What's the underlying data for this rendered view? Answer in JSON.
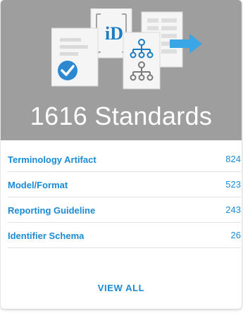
{
  "card": {
    "title": "1616 Standards",
    "header_color": "#9e9e9e",
    "accent_color": "#1a8bd6",
    "art_icons": [
      "document-check-icon",
      "identifier-id-icon",
      "hierarchy-tree-icon",
      "table-export-arrow-icon"
    ],
    "art_id_text": "iD"
  },
  "items": [
    {
      "label": "Terminology Artifact",
      "count": "824"
    },
    {
      "label": "Model/Format",
      "count": "523"
    },
    {
      "label": "Reporting Guideline",
      "count": "243"
    },
    {
      "label": "Identifier Schema",
      "count": "26"
    }
  ],
  "view_all_label": "VIEW ALL"
}
